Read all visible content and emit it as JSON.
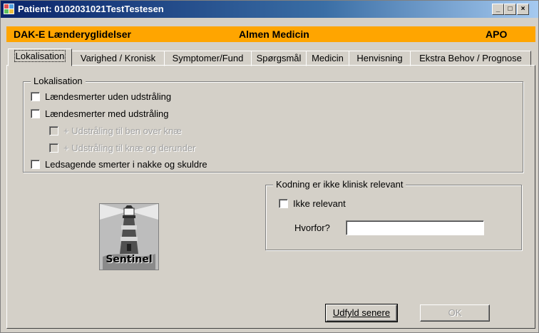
{
  "window": {
    "title": "Patient: 0102031021TestTestesen",
    "buttons": {
      "minimize": "_",
      "maximize": "□",
      "close": "×"
    }
  },
  "header": {
    "left": "DAK-E Lænderyglidelser",
    "center": "Almen Medicin",
    "right": "APO",
    "color": "#ffa500"
  },
  "tabs": [
    {
      "label": "Lokalisation",
      "active": true
    },
    {
      "label": "Varighed / Kronisk"
    },
    {
      "label": "Symptomer/Fund"
    },
    {
      "label": "Spørgsmål"
    },
    {
      "label": "Medicin"
    },
    {
      "label": "Henvisning"
    },
    {
      "label": "Ekstra Behov / Prognose"
    }
  ],
  "lokalisation": {
    "legend": "Lokalisation",
    "items": [
      {
        "label": "Lændesmerter uden udstråling",
        "checked": false,
        "enabled": true
      },
      {
        "label": "Lændesmerter med udstråling",
        "checked": false,
        "enabled": true
      },
      {
        "label": "+ Udstråling til ben over knæ",
        "checked": false,
        "enabled": false
      },
      {
        "label": "+ Udstråling til knæ og derunder",
        "checked": false,
        "enabled": false
      },
      {
        "label": "Ledsagende smerter i nakke og skuldre",
        "checked": false,
        "enabled": true
      }
    ]
  },
  "kodning": {
    "legend": "Kodning er ikke klinisk relevant",
    "checkbox_label": "Ikke relevant",
    "hvorfor_label": "Hvorfor?",
    "hvorfor_value": ""
  },
  "logo": {
    "text": "Sentinel",
    "icon": "lighthouse-icon"
  },
  "footer": {
    "later_label": "Udfyld senere",
    "ok_label": "OK"
  }
}
